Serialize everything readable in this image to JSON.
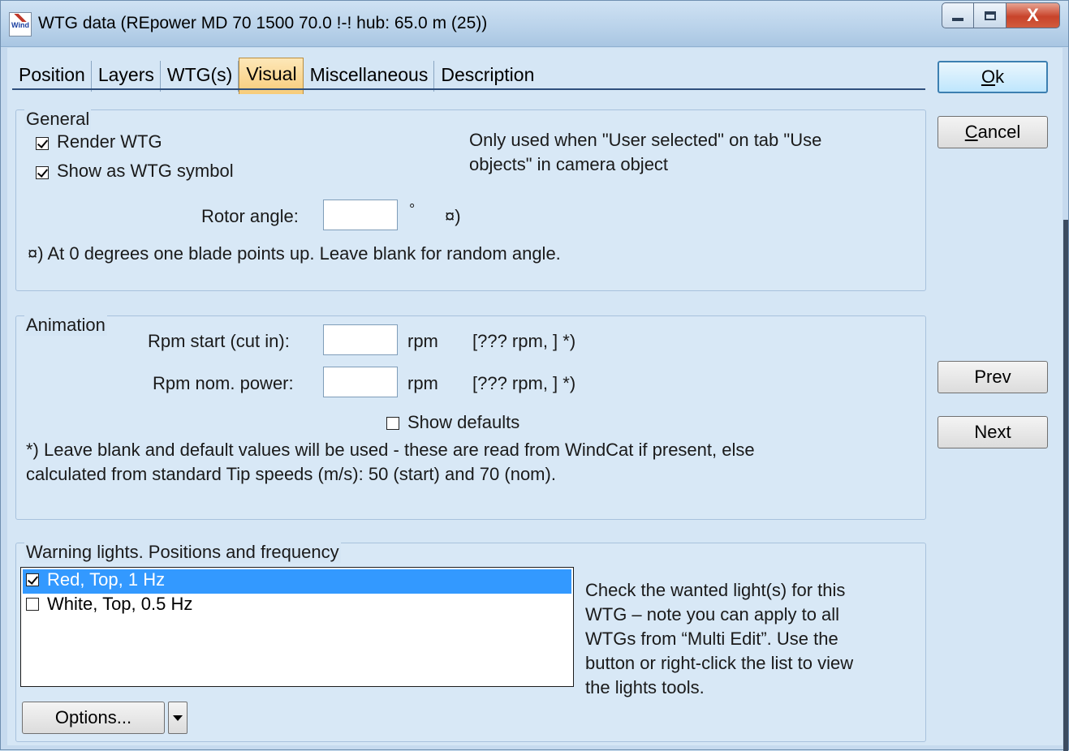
{
  "window": {
    "title": "WTG data   (REpower MD 70 1500 70.0 !-! hub: 65.0 m (25))",
    "close_label": "X"
  },
  "tabs": [
    "Position",
    "Layers",
    "WTG(s)",
    "Visual",
    "Miscellaneous",
    "Description"
  ],
  "active_tab": "Visual",
  "general": {
    "title": "General",
    "render_wtg": {
      "label": "Render WTG",
      "checked": true
    },
    "show_symbol": {
      "label": "Show as WTG symbol",
      "checked": true
    },
    "note_line1": "Only used when \"User selected\" on tab \"Use",
    "note_line2": "objects\" in camera object",
    "rotor_angle_label": "Rotor angle:",
    "rotor_angle_value": "",
    "degree_unit": "°",
    "footnote_marker": "¤)",
    "footnote": "¤) At 0 degrees one blade points up. Leave blank for random angle."
  },
  "animation": {
    "title": "Animation",
    "rpm_start_label": "Rpm start (cut in):",
    "rpm_start_value": "",
    "rpm_start_unit": "rpm",
    "rpm_start_default": "[??? rpm, ] *)",
    "rpm_nom_label": "Rpm nom. power:",
    "rpm_nom_value": "",
    "rpm_nom_unit": "rpm",
    "rpm_nom_default": "[??? rpm, ] *)",
    "show_defaults": {
      "label": "Show defaults",
      "checked": false
    },
    "note_line1": "*) Leave blank and default values will be used - these are read from WindCat if present, else",
    "note_line2": "calculated from standard Tip speeds (m/s): 50 (start) and 70 (nom)."
  },
  "warning_lights": {
    "title": "Warning lights. Positions and frequency",
    "items": [
      {
        "label": "Red, Top, 1 Hz",
        "checked": true,
        "selected": true
      },
      {
        "label": "White, Top, 0.5 Hz",
        "checked": false,
        "selected": false
      }
    ],
    "help_line1": "Check the wanted light(s) for this",
    "help_line2": "WTG – note you can apply to all",
    "help_line3": "WTGs from “Multi Edit”. Use the",
    "help_line4": "button or right-click the list to view",
    "help_line5": "the lights tools.",
    "options_label": "Options..."
  },
  "side_buttons": {
    "ok": "Ok",
    "cancel": "Cancel",
    "prev": "Prev",
    "next": "Next"
  }
}
